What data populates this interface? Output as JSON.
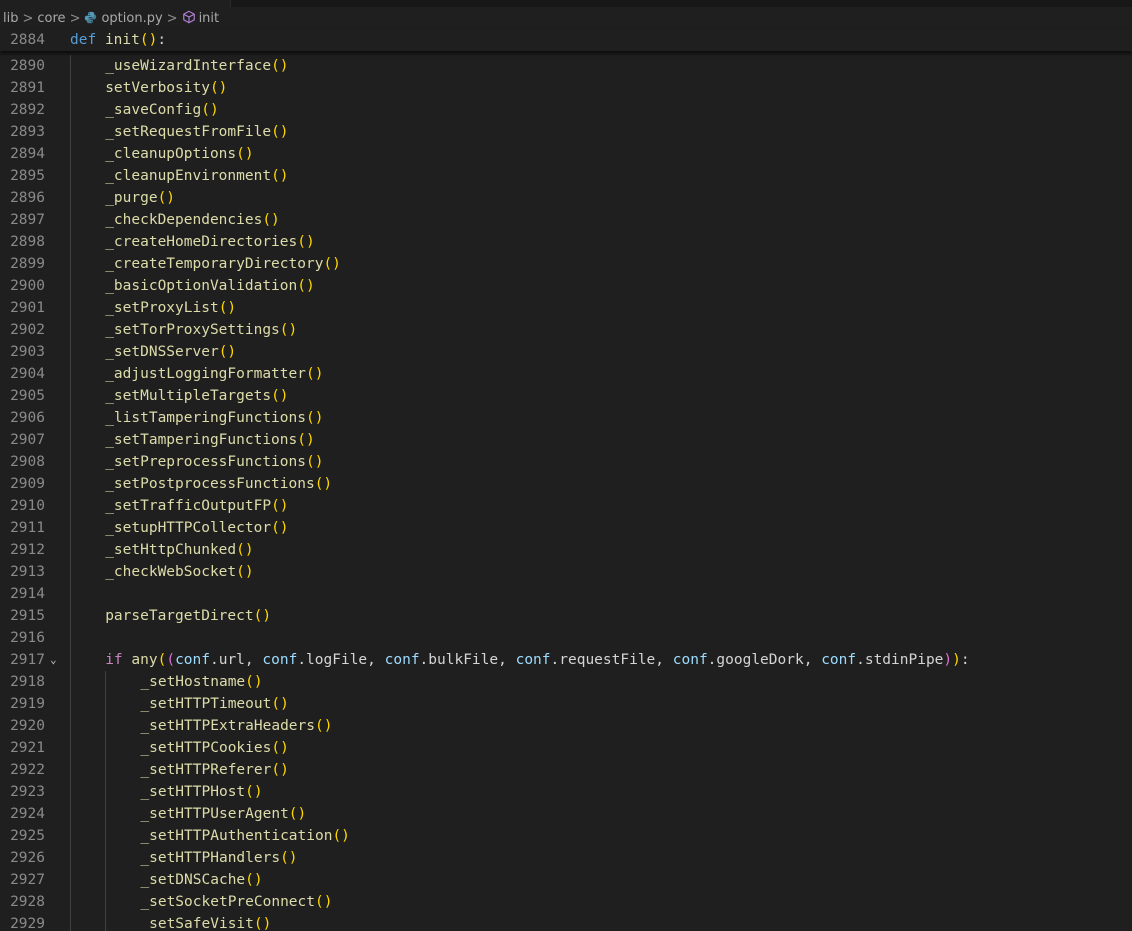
{
  "breadcrumb": {
    "items": [
      "lib",
      "core",
      "option.py",
      "init"
    ],
    "separator": ">"
  },
  "sticky_line": {
    "number": "2884",
    "keyword": "def",
    "name": "init",
    "params": "()",
    "colon": ":"
  },
  "lines": [
    {
      "n": "2890",
      "indent": 1,
      "fn": "_useWizardInterface"
    },
    {
      "n": "2891",
      "indent": 1,
      "fn": "setVerbosity"
    },
    {
      "n": "2892",
      "indent": 1,
      "fn": "_saveConfig"
    },
    {
      "n": "2893",
      "indent": 1,
      "fn": "_setRequestFromFile"
    },
    {
      "n": "2894",
      "indent": 1,
      "fn": "_cleanupOptions"
    },
    {
      "n": "2895",
      "indent": 1,
      "fn": "_cleanupEnvironment"
    },
    {
      "n": "2896",
      "indent": 1,
      "fn": "_purge"
    },
    {
      "n": "2897",
      "indent": 1,
      "fn": "_checkDependencies"
    },
    {
      "n": "2898",
      "indent": 1,
      "fn": "_createHomeDirectories"
    },
    {
      "n": "2899",
      "indent": 1,
      "fn": "_createTemporaryDirectory"
    },
    {
      "n": "2900",
      "indent": 1,
      "fn": "_basicOptionValidation"
    },
    {
      "n": "2901",
      "indent": 1,
      "fn": "_setProxyList"
    },
    {
      "n": "2902",
      "indent": 1,
      "fn": "_setTorProxySettings"
    },
    {
      "n": "2903",
      "indent": 1,
      "fn": "_setDNSServer"
    },
    {
      "n": "2904",
      "indent": 1,
      "fn": "_adjustLoggingFormatter"
    },
    {
      "n": "2905",
      "indent": 1,
      "fn": "_setMultipleTargets"
    },
    {
      "n": "2906",
      "indent": 1,
      "fn": "_listTamperingFunctions"
    },
    {
      "n": "2907",
      "indent": 1,
      "fn": "_setTamperingFunctions"
    },
    {
      "n": "2908",
      "indent": 1,
      "fn": "_setPreprocessFunctions"
    },
    {
      "n": "2909",
      "indent": 1,
      "fn": "_setPostprocessFunctions"
    },
    {
      "n": "2910",
      "indent": 1,
      "fn": "_setTrafficOutputFP"
    },
    {
      "n": "2911",
      "indent": 1,
      "fn": "_setupHTTPCollector"
    },
    {
      "n": "2912",
      "indent": 1,
      "fn": "_setHttpChunked"
    },
    {
      "n": "2913",
      "indent": 1,
      "fn": "_checkWebSocket"
    },
    {
      "n": "2914",
      "indent": 1,
      "fn": ""
    },
    {
      "n": "2915",
      "indent": 1,
      "fn": "parseTargetDirect"
    },
    {
      "n": "2916",
      "indent": 1,
      "fn": ""
    },
    {
      "n": "2917",
      "indent": 1,
      "special": "if"
    },
    {
      "n": "2918",
      "indent": 2,
      "fn": "_setHostname"
    },
    {
      "n": "2919",
      "indent": 2,
      "fn": "_setHTTPTimeout"
    },
    {
      "n": "2920",
      "indent": 2,
      "fn": "_setHTTPExtraHeaders"
    },
    {
      "n": "2921",
      "indent": 2,
      "fn": "_setHTTPCookies"
    },
    {
      "n": "2922",
      "indent": 2,
      "fn": "_setHTTPReferer"
    },
    {
      "n": "2923",
      "indent": 2,
      "fn": "_setHTTPHost"
    },
    {
      "n": "2924",
      "indent": 2,
      "fn": "_setHTTPUserAgent"
    },
    {
      "n": "2925",
      "indent": 2,
      "fn": "_setHTTPAuthentication"
    },
    {
      "n": "2926",
      "indent": 2,
      "fn": "_setHTTPHandlers"
    },
    {
      "n": "2927",
      "indent": 2,
      "fn": "_setDNSCache"
    },
    {
      "n": "2928",
      "indent": 2,
      "fn": "_setSocketPreConnect"
    },
    {
      "n": "2929",
      "indent": 2,
      "fn": "_setSafeVisit"
    }
  ],
  "if_line": {
    "keyword": "if",
    "func": "any",
    "args": [
      {
        "obj": "conf",
        "attr": "url"
      },
      {
        "obj": "conf",
        "attr": "logFile"
      },
      {
        "obj": "conf",
        "attr": "bulkFile"
      },
      {
        "obj": "conf",
        "attr": "requestFile"
      },
      {
        "obj": "conf",
        "attr": "googleDork"
      },
      {
        "obj": "conf",
        "attr": "stdinPipe"
      }
    ]
  },
  "icons": {
    "file": "python-file-icon",
    "symbol": "function-symbol-icon",
    "fold": "chevron-down-icon"
  },
  "colors": {
    "background": "#1f1f1f",
    "line_number": "#8a8a8a",
    "function": "#dcdcaa",
    "keyword_def": "#569cd6",
    "keyword_if": "#c586c0",
    "variable": "#9cdcfe",
    "bracket_level1": "#ffd700",
    "bracket_level2": "#da70d6",
    "bracket_level3": "#179fff",
    "symbol_icon": "#b180d7"
  }
}
